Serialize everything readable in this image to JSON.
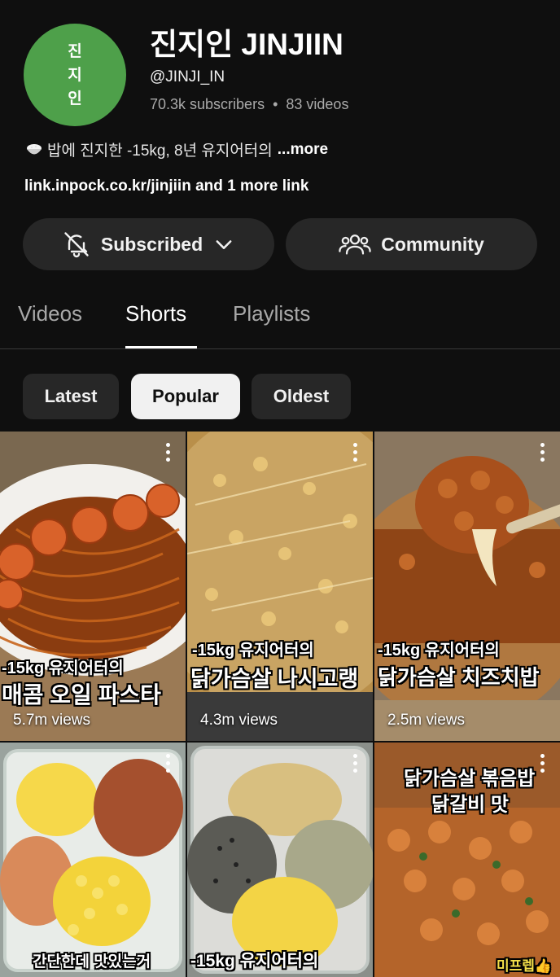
{
  "channel": {
    "avatar_chars": [
      "진",
      "지",
      "인"
    ],
    "name": "진지인 JINJIIN",
    "handle": "@JINJI_IN",
    "subscribers": "70.3k subscribers",
    "videos": "83 videos",
    "separator": "•",
    "description": "밥에 진지한 -15kg, 8년 유지어터의",
    "more_label": "...more",
    "links": "link.inpock.co.kr/jinjiin and 1 more link"
  },
  "buttons": {
    "subscribed": "Subscribed",
    "community": "Community"
  },
  "tabs": [
    {
      "label": "Videos"
    },
    {
      "label": "Shorts"
    },
    {
      "label": "Playlists"
    }
  ],
  "chips": [
    {
      "label": "Latest"
    },
    {
      "label": "Popular"
    },
    {
      "label": "Oldest"
    }
  ],
  "shorts": [
    {
      "caption_line1": "-15kg 유지어터의",
      "caption_line2": "매콤 오일 파스타",
      "views": "5.7m views"
    },
    {
      "caption_line1": "-15kg 유지어터의",
      "caption_line2": "닭가슴살 나시고랭",
      "views": "4.3m views"
    },
    {
      "caption_line1": "-15kg 유지어터의",
      "caption_line2": "닭가슴살 치즈치밥",
      "views": "2.5m views"
    },
    {
      "caption_bottom": "간단한데 맛있는거"
    },
    {
      "caption_bottom": "-15kg 유지어터의"
    },
    {
      "caption_top1": "닭가슴살 볶음밥",
      "caption_top2": "닭갈비 맛",
      "caption_corner": "미프렙👍"
    }
  ],
  "colors": {
    "background": "#0f0f0f",
    "button_bg": "#272727",
    "avatar_green": "#4ea04a",
    "muted_text": "#aaaaaa"
  },
  "icons": [
    "rice-bowl-icon",
    "bell-off-icon",
    "chevron-down-icon",
    "community-icon",
    "more-vert-icon"
  ]
}
